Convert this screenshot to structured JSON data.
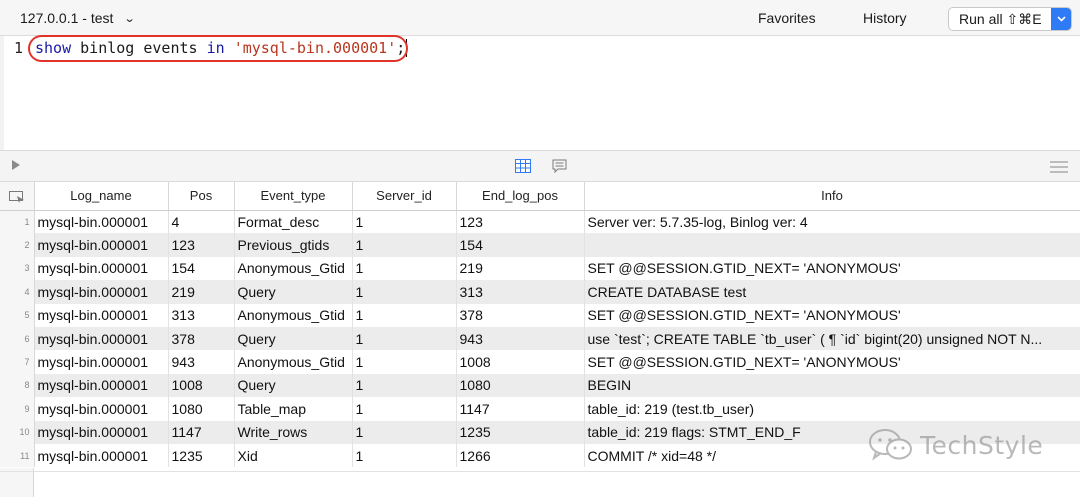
{
  "toolbar": {
    "connection": "127.0.0.1 - test",
    "favorites": "Favorites",
    "history": "History",
    "run_all": "Run all ⇧⌘E"
  },
  "editor": {
    "line_number": "1",
    "tokens": {
      "kw1": "show",
      "t1": " binlog events ",
      "kw2": "in",
      "t2": " ",
      "str": "'mysql-bin.000001'",
      "t3": ";"
    },
    "highlight_color": "#e0342b"
  },
  "results": {
    "columns": [
      "Log_name",
      "Pos",
      "Event_type",
      "Server_id",
      "End_log_pos",
      "Info"
    ],
    "rows": [
      {
        "n": "1",
        "log_name": "mysql-bin.000001",
        "pos": "4",
        "event_type": "Format_desc",
        "server_id": "1",
        "end_log_pos": "123",
        "info": "Server ver: 5.7.35-log, Binlog ver: 4"
      },
      {
        "n": "2",
        "log_name": "mysql-bin.000001",
        "pos": "123",
        "event_type": "Previous_gtids",
        "server_id": "1",
        "end_log_pos": "154",
        "info": ""
      },
      {
        "n": "3",
        "log_name": "mysql-bin.000001",
        "pos": "154",
        "event_type": "Anonymous_Gtid",
        "server_id": "1",
        "end_log_pos": "219",
        "info": "SET @@SESSION.GTID_NEXT= 'ANONYMOUS'"
      },
      {
        "n": "4",
        "log_name": "mysql-bin.000001",
        "pos": "219",
        "event_type": "Query",
        "server_id": "1",
        "end_log_pos": "313",
        "info": "CREATE DATABASE test"
      },
      {
        "n": "5",
        "log_name": "mysql-bin.000001",
        "pos": "313",
        "event_type": "Anonymous_Gtid",
        "server_id": "1",
        "end_log_pos": "378",
        "info": "SET @@SESSION.GTID_NEXT= 'ANONYMOUS'"
      },
      {
        "n": "6",
        "log_name": "mysql-bin.000001",
        "pos": "378",
        "event_type": "Query",
        "server_id": "1",
        "end_log_pos": "943",
        "info": "use `test`; CREATE TABLE `tb_user` ( ¶   `id` bigint(20) unsigned NOT N..."
      },
      {
        "n": "7",
        "log_name": "mysql-bin.000001",
        "pos": "943",
        "event_type": "Anonymous_Gtid",
        "server_id": "1",
        "end_log_pos": "1008",
        "info": "SET @@SESSION.GTID_NEXT= 'ANONYMOUS'"
      },
      {
        "n": "8",
        "log_name": "mysql-bin.000001",
        "pos": "1008",
        "event_type": "Query",
        "server_id": "1",
        "end_log_pos": "1080",
        "info": "BEGIN"
      },
      {
        "n": "9",
        "log_name": "mysql-bin.000001",
        "pos": "1080",
        "event_type": "Table_map",
        "server_id": "1",
        "end_log_pos": "1147",
        "info": "table_id: 219 (test.tb_user)"
      },
      {
        "n": "10",
        "log_name": "mysql-bin.000001",
        "pos": "1147",
        "event_type": "Write_rows",
        "server_id": "1",
        "end_log_pos": "1235",
        "info": "table_id: 219 flags: STMT_END_F"
      },
      {
        "n": "11",
        "log_name": "mysql-bin.000001",
        "pos": "1235",
        "event_type": "Xid",
        "server_id": "1",
        "end_log_pos": "1266",
        "info": "COMMIT /* xid=48 */"
      }
    ]
  },
  "watermark": {
    "text": "TechStyle",
    "icon": "wechat-icon"
  },
  "icons": {
    "run": "play-icon",
    "grid": "grid-view-icon",
    "text": "text-view-icon",
    "menu": "menu-icon",
    "corner": "select-all-icon"
  },
  "colors": {
    "accent": "#2f7bf5",
    "keyword": "#1a1aa6",
    "string": "#b8361e"
  }
}
